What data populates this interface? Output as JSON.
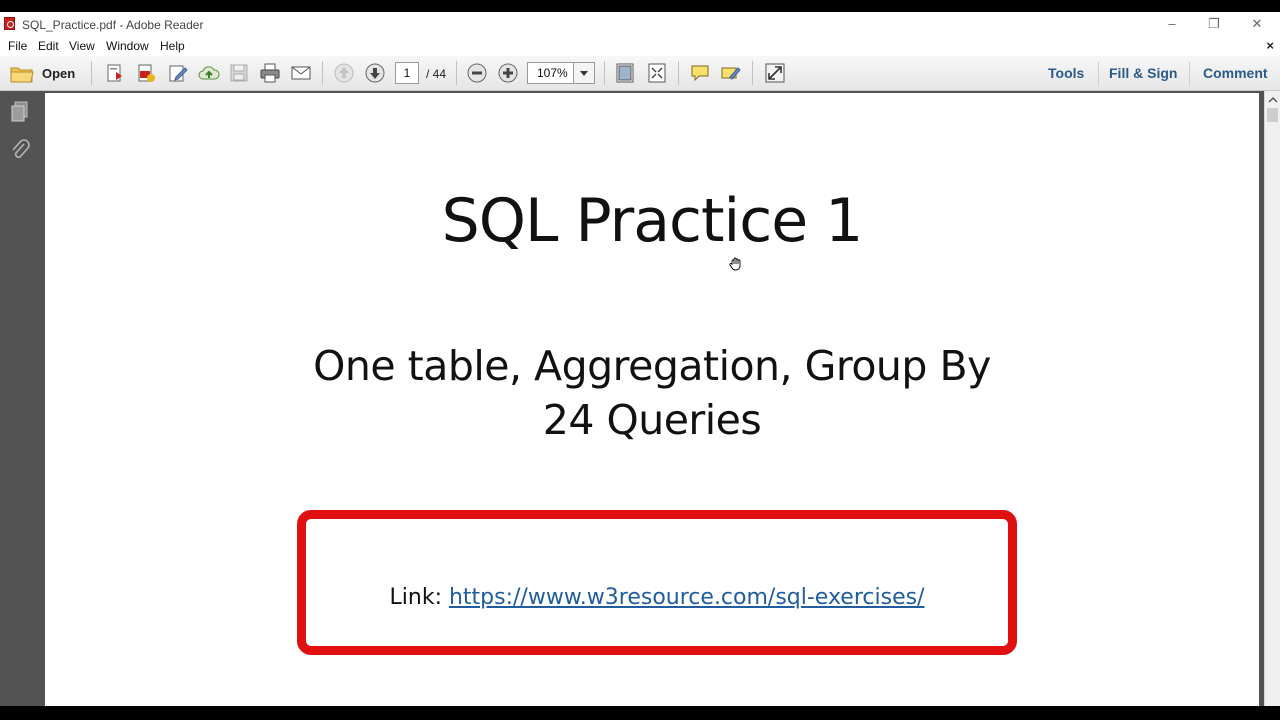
{
  "window": {
    "title": "SQL_Practice.pdf - Adobe Reader"
  },
  "menu": [
    "File",
    "Edit",
    "View",
    "Window",
    "Help"
  ],
  "toolbar": {
    "open_label": "Open",
    "page_current": "1",
    "page_total": "/ 44",
    "zoom": "107%",
    "tools_label": "Tools",
    "fill_sign_label": "Fill & Sign",
    "comment_label": "Comment"
  },
  "document": {
    "title": "SQL Practice 1",
    "subtitle_line1": "One table, Aggregation, Group By",
    "subtitle_line2": "24 Queries",
    "link_label": "Link: ",
    "link_url": "https://www.w3resource.com/sql-exercises/"
  },
  "colors": {
    "link": "#1f5d9e",
    "box_border": "#e01010",
    "accent_links": "#2a5b8a"
  }
}
